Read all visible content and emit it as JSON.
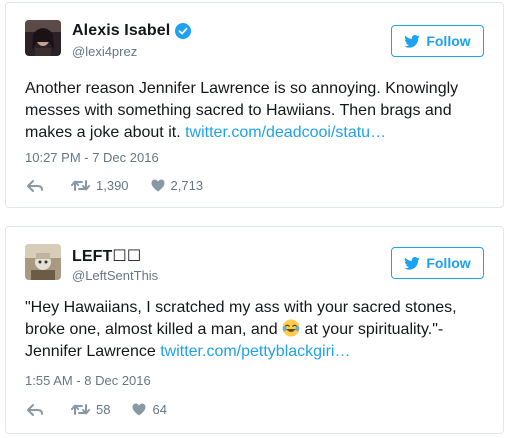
{
  "tweets": [
    {
      "display_name": "Alexis Isabel",
      "handle": "@lexi4prez",
      "verified": true,
      "follow_label": "Follow",
      "text": "Another reason Jennifer Lawrence is so annoying. Knowingly messes with something sacred to Hawiians. Then brags and makes a joke about it.",
      "link": "twitter.com/deadcooi/statu…",
      "timestamp": "10:27 PM - 7 Dec 2016",
      "retweets": "1,390",
      "likes": "2,713"
    },
    {
      "display_name": "LEFT☐☐",
      "handle": "@LeftSentThis",
      "verified": false,
      "follow_label": "Follow",
      "text_before_emoji": "\"Hey Hawaiians, I scratched my ass with your sacred stones, broke one, almost killed a man, and",
      "emoji": "face-with-tears-of-joy",
      "text_after_emoji": "at your spirituality.\"- Jennifer Lawrence",
      "link": "twitter.com/pettyblackgiri…",
      "timestamp": "1:55 AM - 8 Dec 2016",
      "retweets": "58",
      "likes": "64"
    }
  ],
  "colors": {
    "accent": "#1da1f2",
    "text": "#14171a",
    "muted": "#657786",
    "border": "#e1e8ed"
  }
}
